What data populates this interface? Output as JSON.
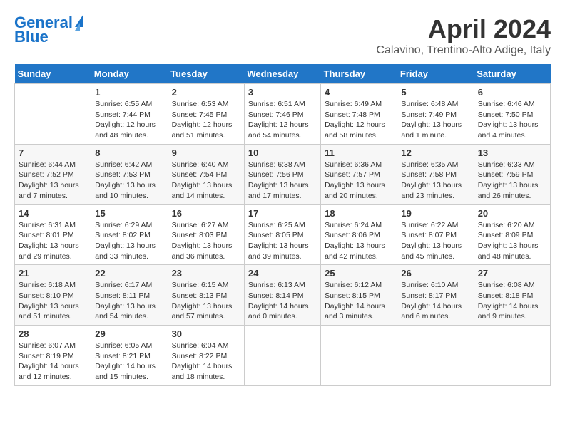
{
  "header": {
    "logo_line1": "General",
    "logo_line2": "Blue",
    "title": "April 2024",
    "subtitle": "Calavino, Trentino-Alto Adige, Italy"
  },
  "days_of_week": [
    "Sunday",
    "Monday",
    "Tuesday",
    "Wednesday",
    "Thursday",
    "Friday",
    "Saturday"
  ],
  "weeks": [
    [
      {
        "num": "",
        "sunrise": "",
        "sunset": "",
        "daylight": ""
      },
      {
        "num": "1",
        "sunrise": "Sunrise: 6:55 AM",
        "sunset": "Sunset: 7:44 PM",
        "daylight": "Daylight: 12 hours and 48 minutes."
      },
      {
        "num": "2",
        "sunrise": "Sunrise: 6:53 AM",
        "sunset": "Sunset: 7:45 PM",
        "daylight": "Daylight: 12 hours and 51 minutes."
      },
      {
        "num": "3",
        "sunrise": "Sunrise: 6:51 AM",
        "sunset": "Sunset: 7:46 PM",
        "daylight": "Daylight: 12 hours and 54 minutes."
      },
      {
        "num": "4",
        "sunrise": "Sunrise: 6:49 AM",
        "sunset": "Sunset: 7:48 PM",
        "daylight": "Daylight: 12 hours and 58 minutes."
      },
      {
        "num": "5",
        "sunrise": "Sunrise: 6:48 AM",
        "sunset": "Sunset: 7:49 PM",
        "daylight": "Daylight: 13 hours and 1 minute."
      },
      {
        "num": "6",
        "sunrise": "Sunrise: 6:46 AM",
        "sunset": "Sunset: 7:50 PM",
        "daylight": "Daylight: 13 hours and 4 minutes."
      }
    ],
    [
      {
        "num": "7",
        "sunrise": "Sunrise: 6:44 AM",
        "sunset": "Sunset: 7:52 PM",
        "daylight": "Daylight: 13 hours and 7 minutes."
      },
      {
        "num": "8",
        "sunrise": "Sunrise: 6:42 AM",
        "sunset": "Sunset: 7:53 PM",
        "daylight": "Daylight: 13 hours and 10 minutes."
      },
      {
        "num": "9",
        "sunrise": "Sunrise: 6:40 AM",
        "sunset": "Sunset: 7:54 PM",
        "daylight": "Daylight: 13 hours and 14 minutes."
      },
      {
        "num": "10",
        "sunrise": "Sunrise: 6:38 AM",
        "sunset": "Sunset: 7:56 PM",
        "daylight": "Daylight: 13 hours and 17 minutes."
      },
      {
        "num": "11",
        "sunrise": "Sunrise: 6:36 AM",
        "sunset": "Sunset: 7:57 PM",
        "daylight": "Daylight: 13 hours and 20 minutes."
      },
      {
        "num": "12",
        "sunrise": "Sunrise: 6:35 AM",
        "sunset": "Sunset: 7:58 PM",
        "daylight": "Daylight: 13 hours and 23 minutes."
      },
      {
        "num": "13",
        "sunrise": "Sunrise: 6:33 AM",
        "sunset": "Sunset: 7:59 PM",
        "daylight": "Daylight: 13 hours and 26 minutes."
      }
    ],
    [
      {
        "num": "14",
        "sunrise": "Sunrise: 6:31 AM",
        "sunset": "Sunset: 8:01 PM",
        "daylight": "Daylight: 13 hours and 29 minutes."
      },
      {
        "num": "15",
        "sunrise": "Sunrise: 6:29 AM",
        "sunset": "Sunset: 8:02 PM",
        "daylight": "Daylight: 13 hours and 33 minutes."
      },
      {
        "num": "16",
        "sunrise": "Sunrise: 6:27 AM",
        "sunset": "Sunset: 8:03 PM",
        "daylight": "Daylight: 13 hours and 36 minutes."
      },
      {
        "num": "17",
        "sunrise": "Sunrise: 6:25 AM",
        "sunset": "Sunset: 8:05 PM",
        "daylight": "Daylight: 13 hours and 39 minutes."
      },
      {
        "num": "18",
        "sunrise": "Sunrise: 6:24 AM",
        "sunset": "Sunset: 8:06 PM",
        "daylight": "Daylight: 13 hours and 42 minutes."
      },
      {
        "num": "19",
        "sunrise": "Sunrise: 6:22 AM",
        "sunset": "Sunset: 8:07 PM",
        "daylight": "Daylight: 13 hours and 45 minutes."
      },
      {
        "num": "20",
        "sunrise": "Sunrise: 6:20 AM",
        "sunset": "Sunset: 8:09 PM",
        "daylight": "Daylight: 13 hours and 48 minutes."
      }
    ],
    [
      {
        "num": "21",
        "sunrise": "Sunrise: 6:18 AM",
        "sunset": "Sunset: 8:10 PM",
        "daylight": "Daylight: 13 hours and 51 minutes."
      },
      {
        "num": "22",
        "sunrise": "Sunrise: 6:17 AM",
        "sunset": "Sunset: 8:11 PM",
        "daylight": "Daylight: 13 hours and 54 minutes."
      },
      {
        "num": "23",
        "sunrise": "Sunrise: 6:15 AM",
        "sunset": "Sunset: 8:13 PM",
        "daylight": "Daylight: 13 hours and 57 minutes."
      },
      {
        "num": "24",
        "sunrise": "Sunrise: 6:13 AM",
        "sunset": "Sunset: 8:14 PM",
        "daylight": "Daylight: 14 hours and 0 minutes."
      },
      {
        "num": "25",
        "sunrise": "Sunrise: 6:12 AM",
        "sunset": "Sunset: 8:15 PM",
        "daylight": "Daylight: 14 hours and 3 minutes."
      },
      {
        "num": "26",
        "sunrise": "Sunrise: 6:10 AM",
        "sunset": "Sunset: 8:17 PM",
        "daylight": "Daylight: 14 hours and 6 minutes."
      },
      {
        "num": "27",
        "sunrise": "Sunrise: 6:08 AM",
        "sunset": "Sunset: 8:18 PM",
        "daylight": "Daylight: 14 hours and 9 minutes."
      }
    ],
    [
      {
        "num": "28",
        "sunrise": "Sunrise: 6:07 AM",
        "sunset": "Sunset: 8:19 PM",
        "daylight": "Daylight: 14 hours and 12 minutes."
      },
      {
        "num": "29",
        "sunrise": "Sunrise: 6:05 AM",
        "sunset": "Sunset: 8:21 PM",
        "daylight": "Daylight: 14 hours and 15 minutes."
      },
      {
        "num": "30",
        "sunrise": "Sunrise: 6:04 AM",
        "sunset": "Sunset: 8:22 PM",
        "daylight": "Daylight: 14 hours and 18 minutes."
      },
      {
        "num": "",
        "sunrise": "",
        "sunset": "",
        "daylight": ""
      },
      {
        "num": "",
        "sunrise": "",
        "sunset": "",
        "daylight": ""
      },
      {
        "num": "",
        "sunrise": "",
        "sunset": "",
        "daylight": ""
      },
      {
        "num": "",
        "sunrise": "",
        "sunset": "",
        "daylight": ""
      }
    ]
  ]
}
